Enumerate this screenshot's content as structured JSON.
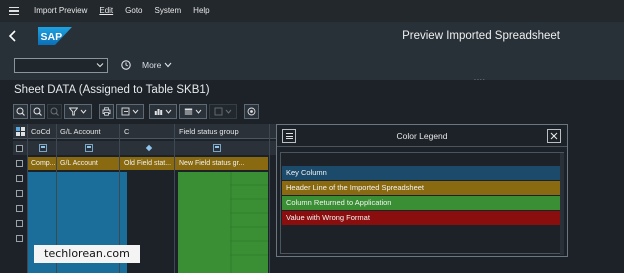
{
  "menubar": {
    "items": [
      "Import Preview",
      "Edit",
      "Goto",
      "System",
      "Help"
    ]
  },
  "header": {
    "title": "Preview Imported Spreadsheet",
    "logo_text": "SAP"
  },
  "toolbar": {
    "select_value": "",
    "more_label": "More",
    "grip": "...."
  },
  "sheet": {
    "title": "Sheet DATA (Assigned to Table SKB1)"
  },
  "table": {
    "columns": [
      "CoCd",
      "G/L Account",
      "C",
      "Field status group"
    ],
    "header_row": [
      "Comp...",
      "G/L Account",
      "Old Field stat...",
      "New Field status gr..."
    ]
  },
  "legend": {
    "title": "Color Legend",
    "items": [
      {
        "label": "Key Column",
        "color": "#1b4a6b"
      },
      {
        "label": "Header Line of the Imported Spreadsheet",
        "color": "#8a6a10"
      },
      {
        "label": "Column Returned to Application",
        "color": "#3a8f34"
      },
      {
        "label": "Value with Wrong Format",
        "color": "#8b0e0e"
      }
    ]
  },
  "watermark": "techlorean.com",
  "colors": {
    "shell": "#23282d",
    "accent_blue": "#1c6e9a",
    "header_gold": "#8a6a10",
    "green": "#3a8f34",
    "error_red": "#8b0e0e"
  }
}
